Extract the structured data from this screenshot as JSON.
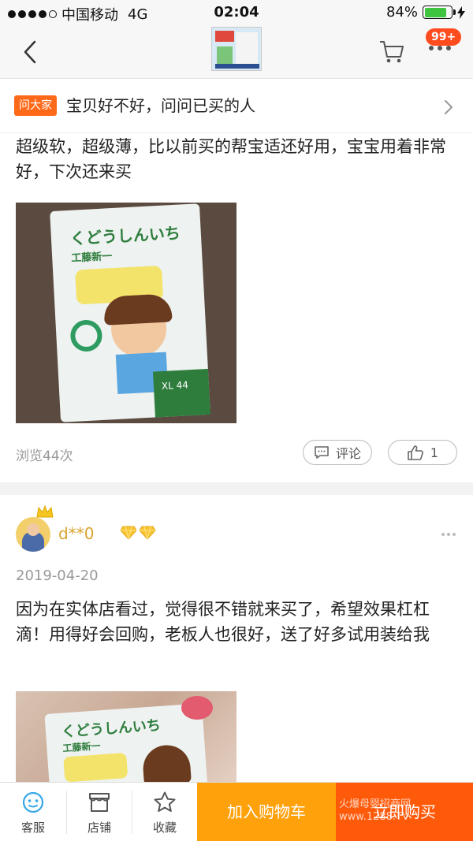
{
  "status_bar": {
    "carrier": "中国移动",
    "network": "4G",
    "time": "02:04",
    "battery": "84%",
    "battery_level": 0.84
  },
  "nav": {
    "badge": "99+"
  },
  "ask": {
    "tag": "问大家",
    "text": "宝贝好不好，问问已买的人"
  },
  "review1": {
    "text": "超级软，超级薄，比以前买的帮宝适还好用，宝宝用着非常好，下次还来买",
    "photo_brand": "くどうしんいち",
    "photo_brand_cn": "工藤新一",
    "photo_size": "XL 44",
    "views": "浏览44次",
    "comment_label": "评论",
    "like_count": "1"
  },
  "review2": {
    "username": "d**0",
    "date": "2019-04-20",
    "text": "因为在实体店看过，觉得很不错就来买了，希望效果杠杠滴！用得好会回购，老板人也很好，送了好多试用装给我",
    "photo_brand": "くどうしんいち",
    "photo_brand_cn": "工藤新一"
  },
  "bottom_bar": {
    "service": "客服",
    "store": "店铺",
    "favorite": "收藏",
    "add_to_cart": "加入购物车",
    "buy_now": "立即购买",
    "watermark_line1": "火爆母婴招商网",
    "watermark_line2": "www.1288.TV"
  },
  "colors": {
    "accent_orange": "#ff6a1a",
    "cart_button": "#ffa10a",
    "buy_button": "#ff5a0a",
    "username_gold": "#d8a42e"
  }
}
